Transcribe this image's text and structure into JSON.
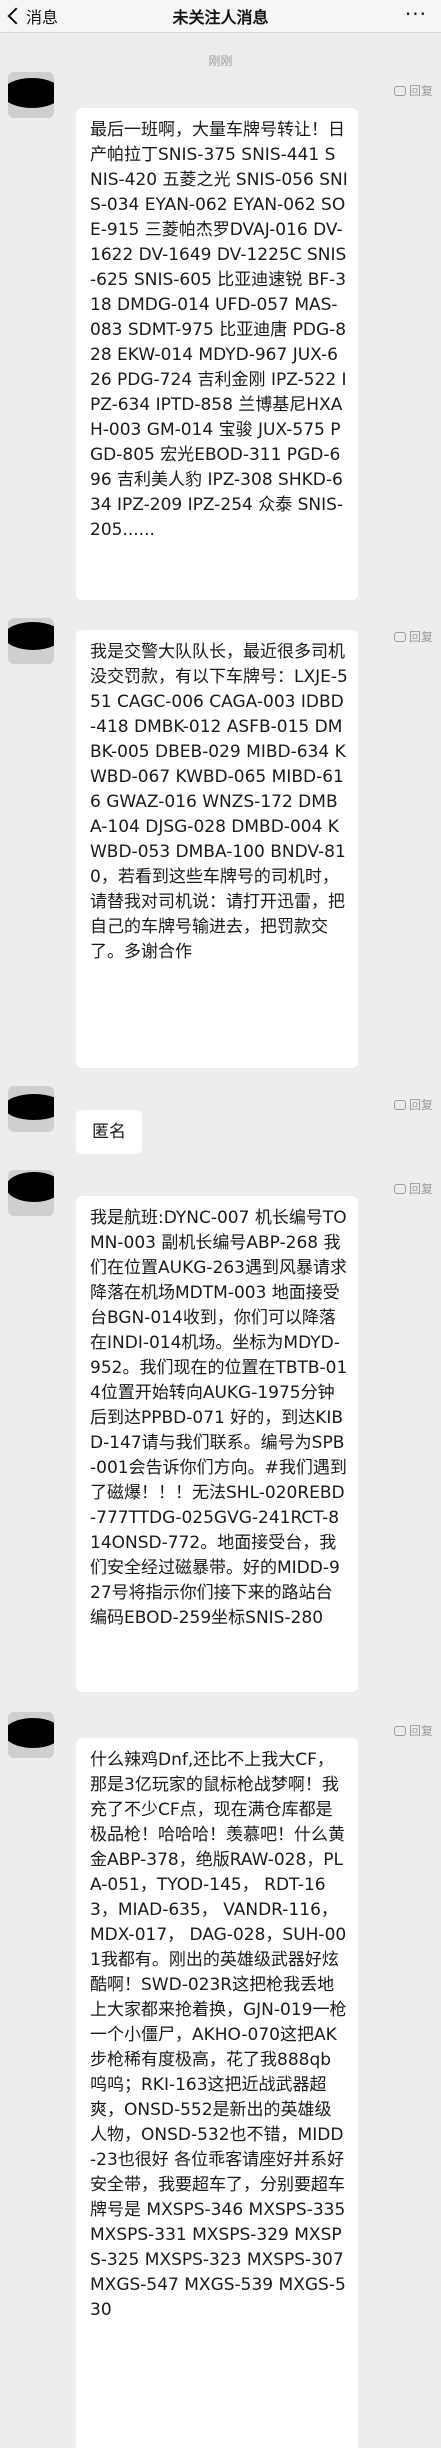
{
  "header": {
    "back_label": "消息",
    "title": "未关注人消息",
    "more": "···"
  },
  "time_label": "刚刚",
  "reply_label": "回复",
  "messages": [
    {
      "text": "最后一班啊，大量车牌号转让！日产帕拉丁SNIS-375 SNIS-441 SNIS-420 五菱之光 SNIS-056 SNIS-034 EYAN-062 EYAN-062 SOE-915 三菱帕杰罗DVAJ-016 DV-1622 DV-1649 DV-1225C SNIS-625 SNIS-605 比亚迪速锐 BF-318 DMDG-014 UFD-057 MAS-083 SDMT-975 比亚迪唐 PDG-828 EKW-014 MDYD-967 JUX-626 PDG-724 吉利金刚 IPZ-522 IPZ-634 IPTD-858 兰博基尼HXAH-003 GM-014 宝骏 JUX-575 PGD-805 宏光EBOD-311 PGD-696 吉利美人豹 IPZ-308 SHKD-634 IPZ-209 IPZ-254 众泰 SNIS-205......"
    },
    {
      "text": "我是交警大队队长，最近很多司机没交罚款，有以下车牌号：LXJE-551 CAGC-006 CAGA-003 IDBD-418 DMBK-012 ASFB-015 DMBK-005 DBEB-029 MIBD-634 KWBD-067 KWBD-065 MIBD-616 GWAZ-016 WNZS-172 DMBA-104 DJSG-028 DMBD-004 KWBD-053 DMBA-100 BNDV-810，若看到这些车牌号的司机时，请替我对司机说：请打开迅雷，把自己的车牌号输进去，把罚款交了。多谢合作"
    },
    {
      "text": "匿名"
    },
    {
      "text": "我是航班:DYNC-007 机长编号TOMN-003 副机长编号ABP-268 我们在位置AUKG-263遇到风暴请求降落在机场MDTM-003 地面接受台BGN-014收到，你们可以降落在INDI-014机场。坐标为MDYD-952。我们现在的位置在TBTB-014位置开始转向AUKG-1975分钟后到达PPBD-071 好的，到达KIBD-147请与我们联系。编号为SPB-001会告诉你们方向。#我们遇到了磁爆！！！无法SHL-020REBD-777TTDG-025GVG-241RCT-814ONSD-772。地面接受台，我们安全经过磁暴带。好的MIDD-927号将指示你们接下来的路站台编码EBOD-259坐标SNIS-280"
    },
    {
      "text": "什么辣鸡Dnf,还比不上我大CF，那是3亿玩家的鼠标枪战梦啊！我充了不少CF点，现在满仓库都是极品枪！哈哈哈！羡慕吧！什么黄金ABP-378，绝版RAW-028，PLA-051，TYOD-145， RDT-163，MIAD-635， VANDR-116，MDX-017， DAG-028，SUH-001我都有。刚出的英雄级武器好炫酷啊！SWD-023R这把枪我丢地上大家都来抢着换，GJN-019一枪一个小僵尸，AKHO-070这把AK步枪稀有度极高，花了我888qb呜呜；RKI-163这把近战武器超爽，ONSD-552是新出的英雄级人物，ONSD-532也不错，MIDD-23也很好 各位乖客请座好并系好安全带，我要超车了，分别要超车牌号是 MXSPS-346 MXSPS-335 MXSPS-331 MXSPS-329 MXSPS-325 MXSPS-323 MXSPS-307 MXGS-547 MXGS-539 MXGS-530"
    }
  ]
}
